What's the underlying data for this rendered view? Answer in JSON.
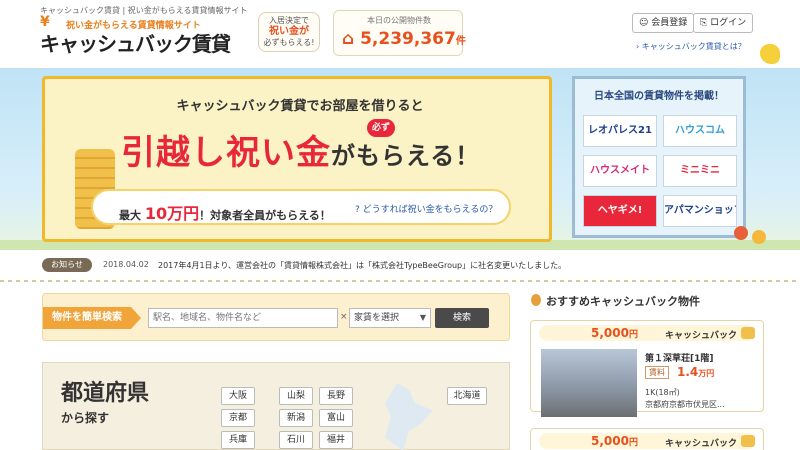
{
  "header": {
    "breadcrumb": "キャッシュバック賃貸 | 祝い金がもらえる賃貸情報サイト",
    "logo_sub": "祝い金がもらえる賃貸情報サイト",
    "logo": "キャッシュバック賃貸",
    "bubble_line1": "入居決定で",
    "bubble_line2": "祝い金が",
    "bubble_line3": "必ずもらえる!",
    "counter_label": "本日の公開物件数",
    "counter_value": "5,239,367",
    "counter_unit": "件",
    "register_label": "会員登録",
    "login_label": "ログイン",
    "about_link": "キャッシュバック賃貸とは？"
  },
  "hero": {
    "lead": "キャッシュバック賃貸でお部屋を借りると",
    "title_main": "引越し祝い金",
    "title_tail": "がもらえる！",
    "must_badge": "必ず",
    "max_prefix": "最大",
    "max_amount": "10万円",
    "max_suffix": "！対象者全員がもらえる！",
    "how_link": "どうすれば祝い金をもらえるの？"
  },
  "partners": {
    "heading": "日本全国の賃貸物件を掲載！",
    "logos": [
      "レオパレス21",
      "ハウスコム",
      "ハウスメイト",
      "ミニミニ",
      "ヘヤギメ!",
      "アパマンショップ"
    ]
  },
  "notice": {
    "tag": "お知らせ",
    "date": "2018.04.02",
    "text": "2017年4月1日より、運営会社の「賃貸情報株式会社」は「株式会社TypeBeeGroup」に社名変更いたしました。"
  },
  "search": {
    "label": "物件を簡単検索",
    "placeholder": "駅名、地域名、物件名など",
    "x_mark": "×",
    "select_value": "家賃を選択",
    "button_label": "検索"
  },
  "prefecture": {
    "heading": "都道府県",
    "subheading": "から探す",
    "col1": [
      "大阪",
      "京都",
      "兵庫"
    ],
    "col2": [
      "山梨",
      "新潟",
      "石川"
    ],
    "col3": [
      "長野",
      "富山",
      "福井"
    ],
    "hokkaido": "北海道"
  },
  "sidebar": {
    "title": "おすすめキャッシュバック物件",
    "cards": [
      {
        "amount": "5,000",
        "amount_unit": "円",
        "kind": "キャッシュバック",
        "name": "第１深草荘[1階]",
        "rent_label": "賃料",
        "rent": "1.4",
        "rent_unit": "万円",
        "layout": "1K(18㎡)",
        "address": "京都府京都市伏見区..."
      },
      {
        "amount": "5,000",
        "amount_unit": "円",
        "kind": "キャッシュバック"
      }
    ]
  },
  "colors": {
    "accent_orange": "#e8801e",
    "accent_red": "#e8283a",
    "link_blue": "#2a5aa8"
  }
}
